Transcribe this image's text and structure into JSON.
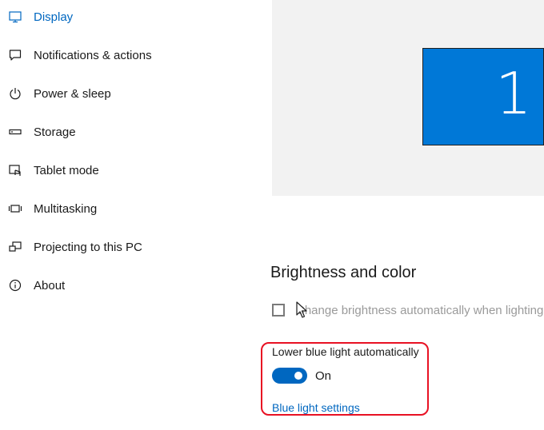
{
  "nav": {
    "items": [
      {
        "label": "Display",
        "icon": "monitor-icon",
        "active": true
      },
      {
        "label": "Notifications & actions",
        "icon": "speech-bubble-icon"
      },
      {
        "label": "Power & sleep",
        "icon": "power-icon"
      },
      {
        "label": "Storage",
        "icon": "storage-icon"
      },
      {
        "label": "Tablet mode",
        "icon": "tablet-mode-icon"
      },
      {
        "label": "Multitasking",
        "icon": "multitasking-icon"
      },
      {
        "label": "Projecting to this PC",
        "icon": "projecting-icon"
      },
      {
        "label": "About",
        "icon": "info-icon"
      }
    ]
  },
  "preview": {
    "monitor_number": "1",
    "monitor_color": "#0078d7"
  },
  "brightness": {
    "heading": "Brightness and color",
    "auto_brightness_label": "Change brightness automatically when lighting"
  },
  "blue_light": {
    "label": "Lower blue light automatically",
    "toggle_state": "On",
    "settings_link": "Blue light settings",
    "accent_color": "#0067c0",
    "highlight_color": "#e81123"
  }
}
